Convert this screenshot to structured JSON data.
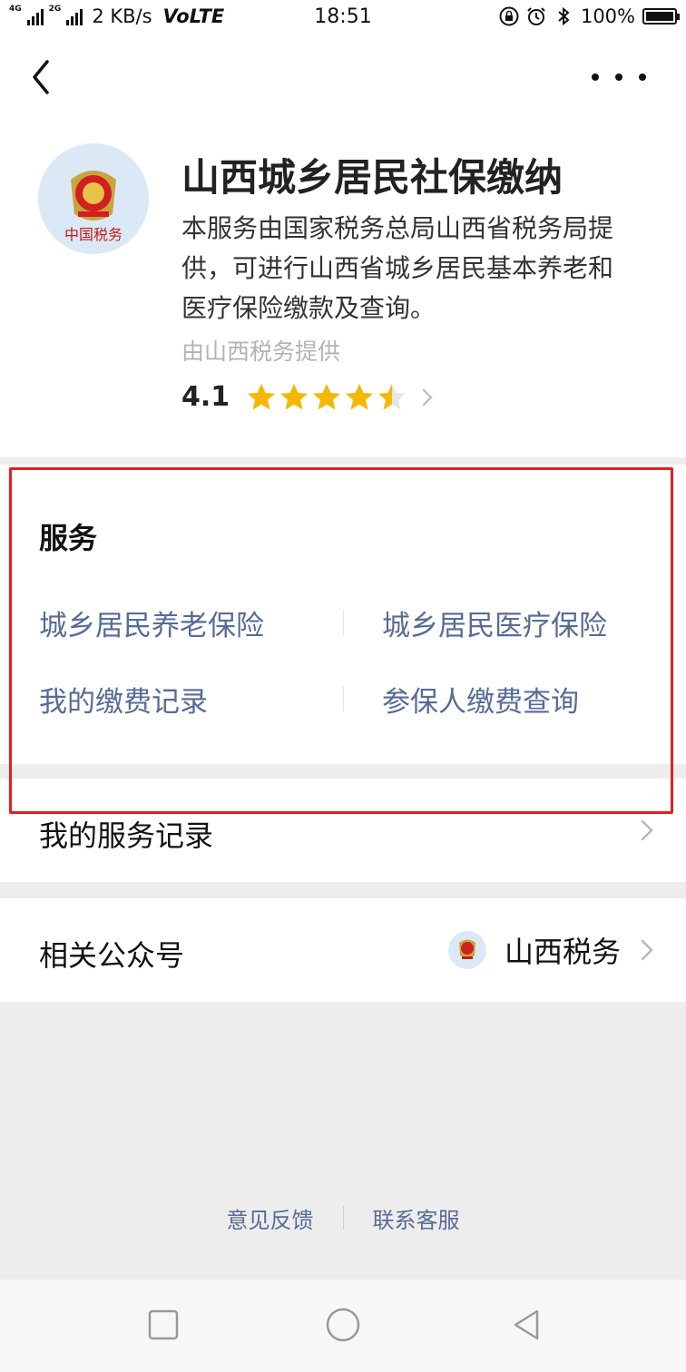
{
  "status_bar": {
    "network_a": "4G",
    "network_b": "2G",
    "speed": "2 KB/s",
    "volte": "VoLTE",
    "time": "18:51",
    "battery": "100%",
    "icons": [
      "lock-icon",
      "alarm-icon",
      "bluetooth-icon",
      "battery-icon"
    ]
  },
  "nav": {
    "back_icon": "chevron-left-icon",
    "more_icon": "more-dots-icon"
  },
  "app": {
    "title": "山西城乡居民社保缴纳",
    "description": "本服务由国家税务总局山西省税务局提供，可进行山西省城乡居民基本养老和医疗保险缴款及查询。",
    "provider": "由山西税务提供",
    "rating": "4.1",
    "rating_stars": 4.5,
    "logo_text": "中国税务"
  },
  "services": {
    "title": "服务",
    "items": [
      {
        "label": "城乡居民养老保险"
      },
      {
        "label": "城乡居民医疗保险"
      },
      {
        "label": "我的缴费记录"
      },
      {
        "label": "参保人缴费查询"
      }
    ]
  },
  "rows": {
    "service_record": "我的服务记录",
    "related_account": "相关公众号",
    "related_account_value": "山西税务"
  },
  "footer": {
    "feedback": "意见反馈",
    "contact": "联系客服"
  },
  "colors": {
    "link": "#576b95",
    "star": "#f5b800",
    "highlight": "#e21f1f",
    "background": "#ededed"
  }
}
